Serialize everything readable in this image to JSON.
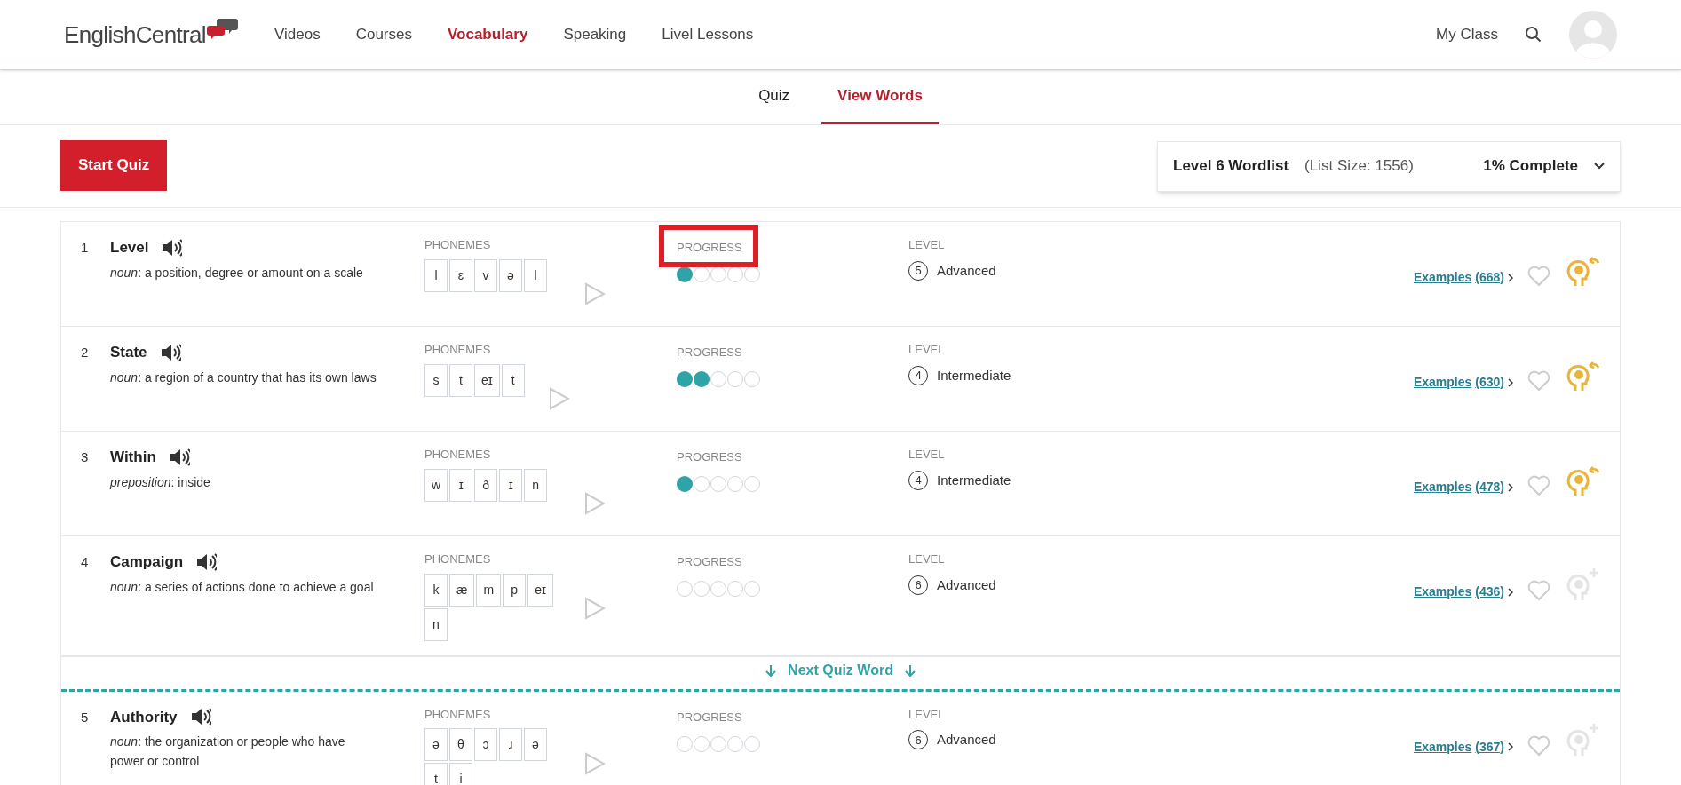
{
  "header": {
    "logo": "EnglishCentral",
    "nav": [
      {
        "label": "Videos",
        "selected": false
      },
      {
        "label": "Courses",
        "selected": false
      },
      {
        "label": "Vocabulary",
        "selected": true
      },
      {
        "label": "Speaking",
        "selected": false
      },
      {
        "label": "Livel Lessons",
        "selected": false
      }
    ],
    "my_class": "My Class"
  },
  "tabs": [
    {
      "label": "Quiz",
      "selected": false
    },
    {
      "label": "View Words",
      "selected": true
    }
  ],
  "toolbar": {
    "start_button": "Start Quiz",
    "wordlist": {
      "title": "Level 6 Wordlist",
      "size": "(List Size: 1556)",
      "complete": "1% Complete"
    }
  },
  "words": [
    {
      "number": "1",
      "word": "Level",
      "definition": "*noun*: a position, degree or amount on a scale",
      "phonemes_label": "PHONEMES",
      "phonemes": [
        "l",
        "ɛ",
        "v",
        "ə",
        "l"
      ],
      "progress_label": "PROGRESS",
      "progress_highlighted": true,
      "stars": 1,
      "level_label": "LEVEL",
      "level_number": "5",
      "level_name": "Advanced",
      "examples": "Examples",
      "examples_count": "(668)",
      "memorized": true
    },
    {
      "number": "2",
      "word": "State",
      "definition": "*noun*: a region of a country that has its own laws",
      "phonemes_label": "PHONEMES",
      "phonemes": [
        "s",
        "t",
        "eɪ",
        "t"
      ],
      "progress_label": "PROGRESS",
      "progress_highlighted": false,
      "stars": 2,
      "level_label": "LEVEL",
      "level_number": "4",
      "level_name": "Intermediate",
      "examples": "Examples",
      "examples_count": "(630)",
      "memorized": true
    },
    {
      "number": "3",
      "word": "Within",
      "definition": "*preposition*: inside",
      "phonemes_label": "PHONEMES",
      "phonemes": [
        "w",
        "ɪ",
        "ð",
        "ɪ",
        "n"
      ],
      "progress_label": "PROGRESS",
      "progress_highlighted": false,
      "stars": 1,
      "level_label": "LEVEL",
      "level_number": "4",
      "level_name": "Intermediate",
      "examples": "Examples",
      "examples_count": "(478)",
      "memorized": true
    },
    {
      "number": "4",
      "word": "Campaign",
      "definition": "*noun*: a series of actions done to achieve a goal",
      "phonemes_label": "PHONEMES",
      "phonemes": [
        "k",
        "æ",
        "m",
        "p",
        "eɪ",
        "n"
      ],
      "progress_label": "PROGRESS",
      "progress_highlighted": false,
      "stars": 0,
      "level_label": "LEVEL",
      "level_number": "6",
      "level_name": "Advanced",
      "examples": "Examples",
      "examples_count": "(436)",
      "memorized": false
    },
    {
      "kind": "divider",
      "label": "Next Quiz Word"
    },
    {
      "number": "5",
      "word": "Authority",
      "definition": "*noun*: the organization or people who have power or control",
      "phonemes_label": "PHONEMES",
      "phonemes": [
        "ə",
        "θ",
        "ɔ",
        "ɹ",
        "ə",
        "t",
        "i"
      ],
      "progress_label": "PROGRESS",
      "progress_highlighted": false,
      "stars": 0,
      "level_label": "LEVEL",
      "level_number": "6",
      "level_name": "Advanced",
      "examples": "Examples",
      "examples_count": "(367)",
      "memorized": false
    }
  ]
}
